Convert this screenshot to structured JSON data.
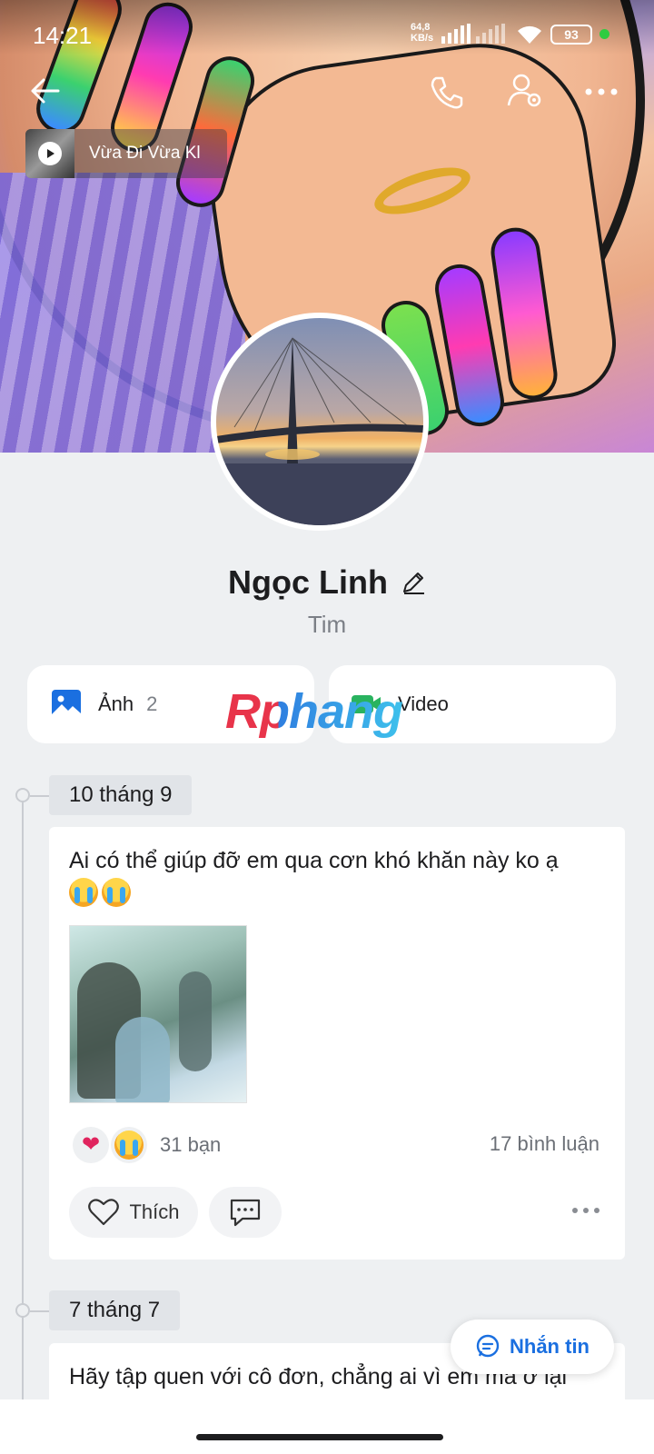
{
  "status_bar": {
    "time": "14:21",
    "net_speed": "64,8",
    "net_unit": "KB/s",
    "battery": "93"
  },
  "music": {
    "title": "Vừa Đi Vừa Kl"
  },
  "profile": {
    "name": "Ngọc Linh",
    "subtitle": "Tim"
  },
  "media": {
    "photo_label": "Ảnh",
    "photo_count": "2",
    "video_label": "Video"
  },
  "watermark": "Rphang",
  "timeline": [
    {
      "date": "10 tháng 9",
      "text": "Ai có thể giúp đỡ em qua cơn khó khăn này ko ạ",
      "reactions_count": "31 bạn",
      "comments": "17 bình luận",
      "like_label": "Thích"
    },
    {
      "date": "7 tháng 7",
      "text": "Hãy tập quen với cô đơn, chẳng ai vì em mà ở lại"
    }
  ],
  "message_button": "Nhắn tin",
  "icons": {
    "back": "back-arrow-icon",
    "call": "phone-icon",
    "settings": "user-settings-icon",
    "more": "more-dots-icon",
    "edit": "pencil-icon",
    "photo": "image-icon",
    "video": "video-camera-icon",
    "heart": "heart-icon",
    "cry": "crying-face-icon",
    "like": "heart-outline-icon",
    "comment": "comment-icon",
    "message": "chat-bubble-icon"
  },
  "colors": {
    "accent": "#1a6fe0",
    "background": "#eef0f2",
    "heart": "#e0245e"
  }
}
